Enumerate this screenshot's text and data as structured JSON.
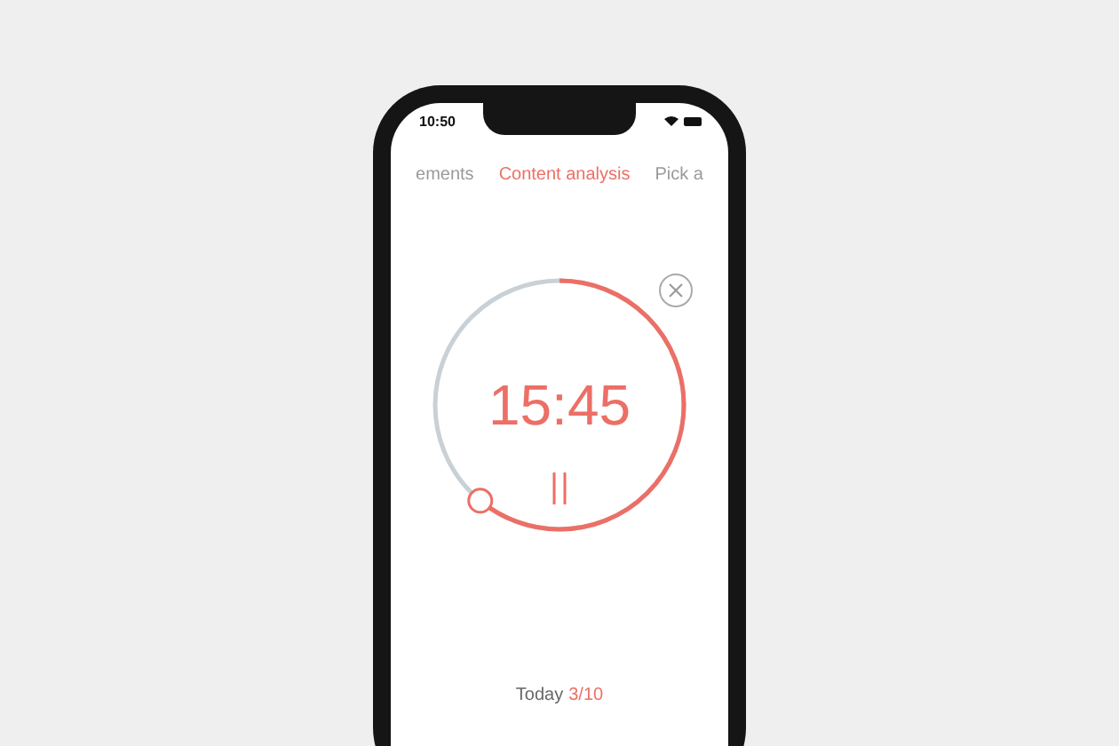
{
  "status_bar": {
    "time": "10:50"
  },
  "tabs": [
    {
      "label": "ements",
      "selected": false
    },
    {
      "label": "Content analysis",
      "selected": true
    },
    {
      "label": "Pick a",
      "selected": false
    }
  ],
  "timer": {
    "time": "15:45",
    "level": 0.61
  },
  "footer": {
    "label": "Today",
    "count": "3/10"
  }
}
